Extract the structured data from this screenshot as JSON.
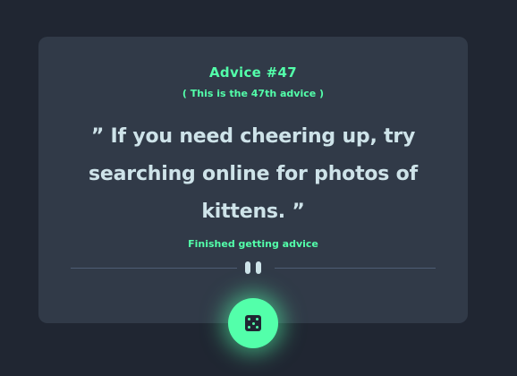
{
  "advice": {
    "title": "Advice #47",
    "subtitle": "( This is the 47th advice )",
    "quote": "” If you need cheering up, try searching online for photos of kittens. ”",
    "status": "Finished getting advice"
  },
  "icons": {
    "divider": "pause-icon",
    "button": "dice-icon"
  },
  "colors": {
    "background": "#202632",
    "card": "#313a48",
    "accent": "#53ffaa",
    "text": "#cee3e9",
    "divider": "#4f5d74"
  }
}
